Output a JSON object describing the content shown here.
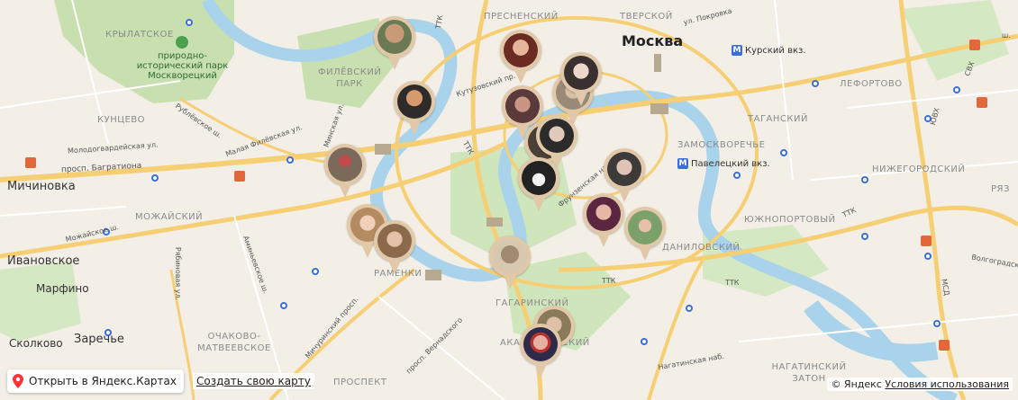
{
  "map": {
    "city": "Москва",
    "districts": [
      "ПРЕСНЕНСКИЙ",
      "ТВЕРСКОЙ",
      "КРЫЛАТСКОЕ",
      "ФИЛЁВСКИЙ ПАРК",
      "КУНЦЕВО",
      "ЛЕФОРТОВО",
      "ТАГАНСКИЙ",
      "ЗАМОСКВОРЕЧЬЕ",
      "НИЖЕГОРОДСКИЙ",
      "МОЖАЙСКИЙ",
      "ЮЖНОПОРТОВЫЙ",
      "ДАНИЛОВСКИЙ",
      "РАМЕНКИ",
      "ГАГАРИНСКИЙ",
      "АКАДЕМИЧЕСКИЙ",
      "ОЧАКОВО-МАТВЕЕВСКОЕ",
      "НАГАТИНСКИЙ ЗАТОН",
      "ПРОСПЕКТ",
      "РЯЗ"
    ],
    "places": [
      "Ивановское",
      "Марфино",
      "Сколково",
      "Заречье",
      "Мичиновка"
    ],
    "poi": "природно-исторический парк Москворецкий",
    "stations": [
      "Курский вкз.",
      "Павелецкий вкз."
    ],
    "streets": [
      "ул. Покровка",
      "Кутузовский пр.",
      "Рублёвское ш.",
      "Малая Филёвская ул.",
      "Молодогвардейская ул.",
      "просп. Багратиона",
      "Можайское ш.",
      "Минская ул.",
      "Аминьевское ш.",
      "Рябиновая ул.",
      "Мичуринский просп.",
      "просп. Вернадского",
      "Фрунзенская наб.",
      "Нагатинская наб.",
      "Волгоградский",
      "ТТК",
      "МСД",
      "СВХ",
      "ЮВХ",
      "ш."
    ],
    "pin_count": 21
  },
  "controls": {
    "open_label": "Открыть в Яндекс.Картах",
    "create_label": "Создать свою карту",
    "copyright": "© Яндекс",
    "terms": "Условия использования"
  },
  "colors": {
    "pin": "#e0c8a8",
    "road": "#f6cf75",
    "water": "#a9d3ea",
    "park": "#c8e0b0",
    "metro": "#3a6fd8"
  }
}
